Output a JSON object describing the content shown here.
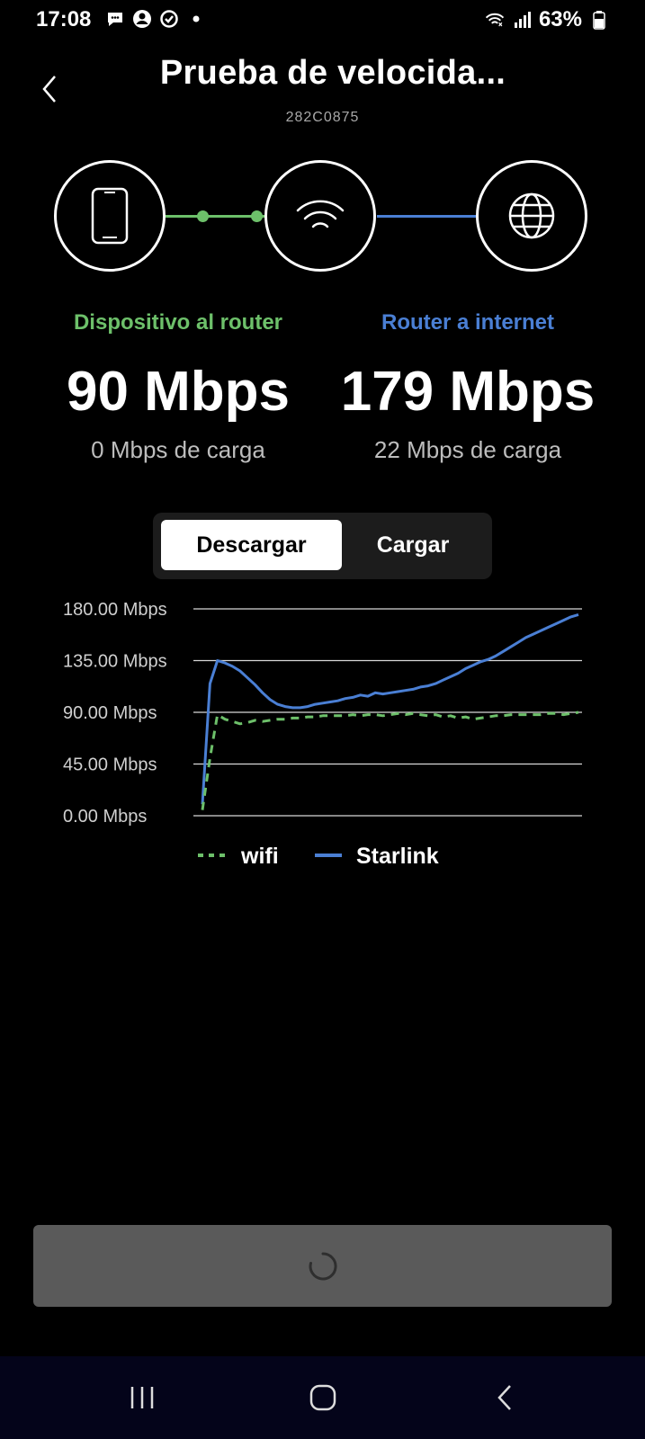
{
  "status_bar": {
    "time": "17:08",
    "battery_percent": "63%",
    "icons": [
      "message-bubble-icon",
      "account-icon",
      "sync-icon",
      "dot-icon",
      "wifi-icon",
      "signal-icon",
      "battery-icon"
    ]
  },
  "header": {
    "title": "Prueba de velocida...",
    "subtitle": "282C0875"
  },
  "diagram": {
    "nodes": [
      "phone-icon",
      "wifi-icon",
      "globe-icon"
    ],
    "device_link_color": "#6dc06a",
    "internet_link_color": "#4a7fd4"
  },
  "stats": {
    "device": {
      "label": "Dispositivo al router",
      "download": "90 Mbps",
      "upload": "0 Mbps de carga",
      "color": "#6dc06a"
    },
    "internet": {
      "label": "Router a internet",
      "download": "179 Mbps",
      "upload": "22 Mbps de carga",
      "color": "#4a7fd4"
    }
  },
  "tabs": {
    "download": "Descargar",
    "upload": "Cargar",
    "selected": "download"
  },
  "chart_data": {
    "type": "line",
    "title": "",
    "xlabel": "",
    "ylabel": "",
    "ylim": [
      0,
      180
    ],
    "yticks": [
      "180.00 Mbps",
      "135.00 Mbps",
      "90.00 Mbps",
      "45.00 Mbps",
      "0.00 Mbps"
    ],
    "ytick_values": [
      180,
      135,
      90,
      45,
      0
    ],
    "grid": true,
    "legend_position": "bottom",
    "x": [
      0,
      1,
      2,
      3,
      4,
      5,
      6,
      7,
      8,
      9,
      10,
      11,
      12,
      13,
      14,
      15,
      16,
      17,
      18,
      19,
      20,
      21,
      22,
      23,
      24,
      25,
      26,
      27,
      28,
      29,
      30,
      31,
      32,
      33,
      34,
      35,
      36,
      37,
      38,
      39,
      40,
      41,
      42,
      43,
      44,
      45,
      46,
      47,
      48,
      49,
      50
    ],
    "series": [
      {
        "name": "wifi",
        "style": "dashed",
        "color": "#6dc06a",
        "values": [
          5,
          50,
          88,
          84,
          82,
          80,
          81,
          83,
          82,
          83,
          84,
          84,
          85,
          85,
          86,
          86,
          87,
          87,
          87,
          87,
          88,
          87,
          88,
          88,
          87,
          88,
          89,
          88,
          89,
          88,
          87,
          88,
          86,
          87,
          85,
          86,
          84,
          85,
          86,
          87,
          87,
          88,
          88,
          88,
          88,
          88,
          89,
          89,
          88,
          89,
          90
        ]
      },
      {
        "name": "Starlink",
        "style": "solid",
        "color": "#4a7fd4",
        "values": [
          10,
          115,
          135,
          133,
          130,
          126,
          120,
          114,
          107,
          101,
          97,
          95,
          94,
          94,
          95,
          97,
          98,
          99,
          100,
          102,
          103,
          105,
          104,
          107,
          106,
          107,
          108,
          109,
          110,
          112,
          113,
          115,
          118,
          121,
          124,
          128,
          131,
          134,
          136,
          139,
          143,
          147,
          151,
          155,
          158,
          161,
          164,
          167,
          170,
          173,
          175
        ]
      }
    ]
  },
  "action_button": {
    "state": "loading"
  },
  "nav_bar": [
    "recents-icon",
    "home-icon",
    "back-icon"
  ]
}
